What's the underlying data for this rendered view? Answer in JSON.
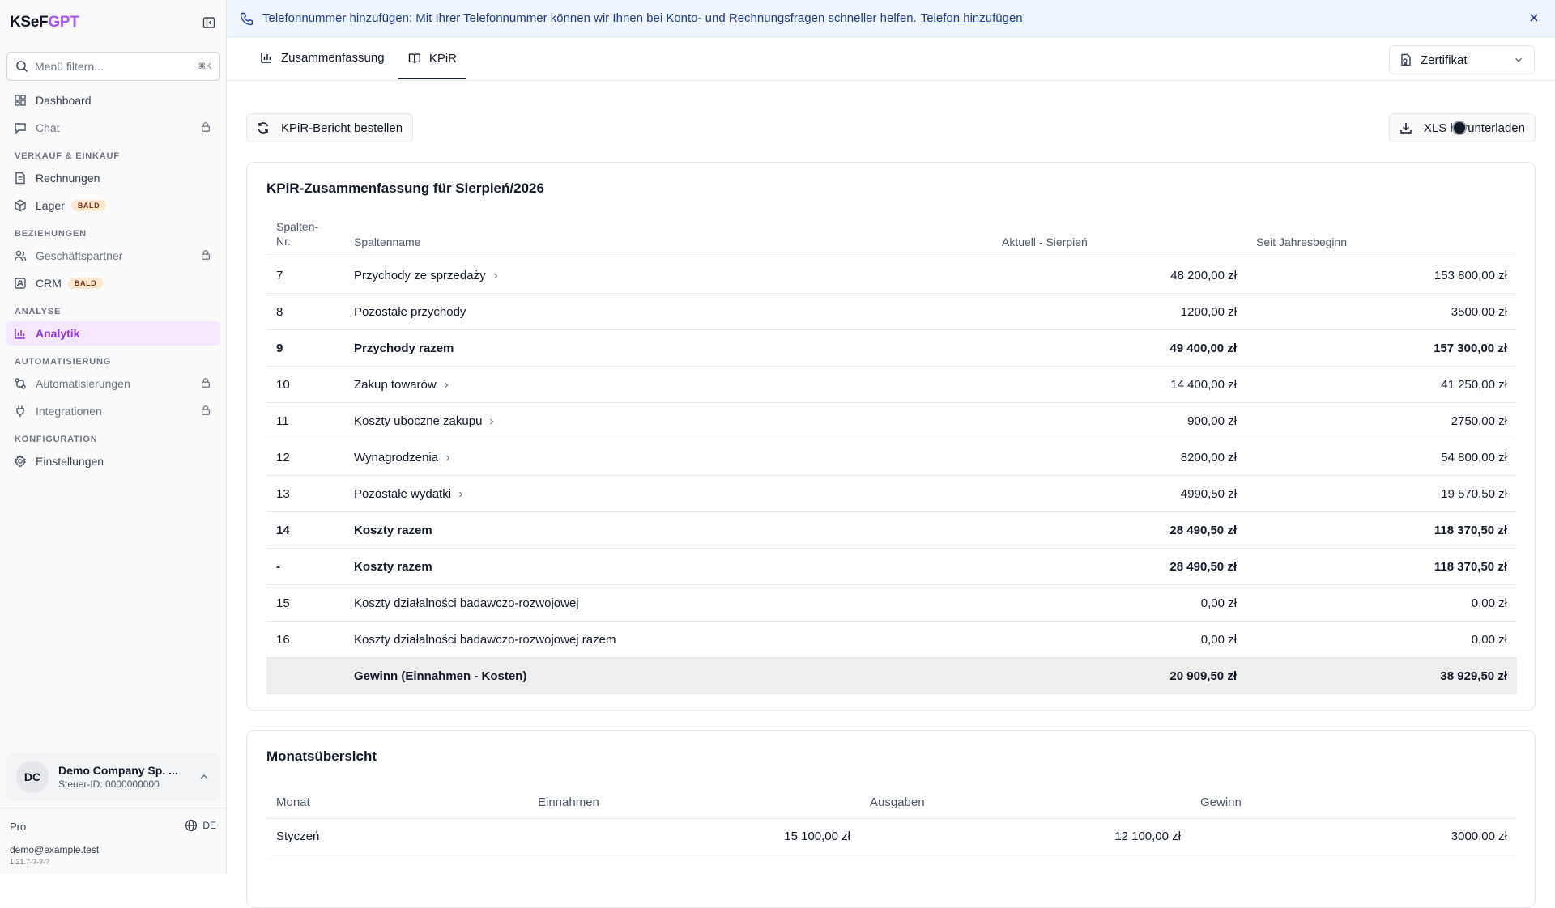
{
  "brand": {
    "name_a": "KSeF",
    "name_b": "GPT"
  },
  "search": {
    "placeholder": "Menü filtern...",
    "shortcut": "⌘K"
  },
  "sidebar": {
    "top_items": [
      {
        "label": "Dashboard",
        "icon": "dashboard-icon"
      },
      {
        "label": "Chat",
        "icon": "chat-icon",
        "locked": true
      }
    ],
    "sections": [
      {
        "title": "VERKAUF & EINKAUF",
        "items": [
          {
            "label": "Rechnungen",
            "icon": "invoice-icon"
          },
          {
            "label": "Lager",
            "icon": "box-icon",
            "badge": "BALD"
          }
        ]
      },
      {
        "title": "BEZIEHUNGEN",
        "items": [
          {
            "label": "Geschäftspartner",
            "icon": "users-icon",
            "locked": true
          },
          {
            "label": "CRM",
            "icon": "contact-icon",
            "badge": "BALD"
          }
        ]
      },
      {
        "title": "ANALYSE",
        "items": [
          {
            "label": "Analytik",
            "icon": "bar-chart-icon",
            "active": true
          }
        ]
      },
      {
        "title": "AUTOMATISIERUNG",
        "items": [
          {
            "label": "Automatisierungen",
            "icon": "workflow-icon",
            "locked": true
          },
          {
            "label": "Integrationen",
            "icon": "plug-icon",
            "locked": true
          }
        ]
      },
      {
        "title": "KONFIGURATION",
        "items": [
          {
            "label": "Einstellungen",
            "icon": "gear-icon"
          }
        ]
      }
    ]
  },
  "company": {
    "initials": "DC",
    "name": "Demo Company Sp. ...",
    "tax_id": "Steuer-ID: 0000000000"
  },
  "footer": {
    "plan": "Pro",
    "language": "DE",
    "email": "demo@example.test",
    "version": "1.21.7-?-?-?"
  },
  "banner": {
    "text": "Telefonnummer hinzufügen: Mit Ihrer Telefonnummer können wir Ihnen bei Konto- und Rechnungsfragen schneller helfen.",
    "link": "Telefon hinzufügen"
  },
  "tabs": [
    {
      "label": "Zusammenfassung",
      "icon": "bar-chart-icon"
    },
    {
      "label": "KPiR",
      "icon": "book-icon",
      "active": true
    }
  ],
  "certificate": {
    "label": "Zertifikat"
  },
  "actions": {
    "order_report": "KPiR-Bericht bestellen",
    "download_xls": "XLS herunterladen"
  },
  "kpir": {
    "title": "KPiR-Zusammenfassung für Sierpień/2026",
    "columns": [
      "Spalten-\nNr.",
      "Spaltenname",
      "Aktuell - Sierpień",
      "Seit Jahresbeginn"
    ],
    "rows": [
      {
        "nr": "7",
        "name": "Przychody ze sprzedaży",
        "current": "48 200,00 zł",
        "ytd": "153 800,00 zł",
        "expandable": true
      },
      {
        "nr": "8",
        "name": "Pozostałe przychody",
        "current": "1200,00 zł",
        "ytd": "3500,00 zł"
      },
      {
        "nr": "9",
        "name": "Przychody razem",
        "current": "49 400,00 zł",
        "ytd": "157 300,00 zł",
        "bold": true
      },
      {
        "nr": "10",
        "name": "Zakup towarów",
        "current": "14 400,00 zł",
        "ytd": "41 250,00 zł",
        "expandable": true
      },
      {
        "nr": "11",
        "name": "Koszty uboczne zakupu",
        "current": "900,00 zł",
        "ytd": "2750,00 zł",
        "expandable": true
      },
      {
        "nr": "12",
        "name": "Wynagrodzenia",
        "current": "8200,00 zł",
        "ytd": "54 800,00 zł",
        "expandable": true
      },
      {
        "nr": "13",
        "name": "Pozostałe wydatki",
        "current": "4990,50 zł",
        "ytd": "19 570,50 zł",
        "expandable": true
      },
      {
        "nr": "14",
        "name": "Koszty razem",
        "current": "28 490,50 zł",
        "ytd": "118 370,50 zł",
        "bold": true
      },
      {
        "nr": "-",
        "name": "Koszty razem",
        "current": "28 490,50 zł",
        "ytd": "118 370,50 zł",
        "bold": true
      },
      {
        "nr": "15",
        "name": "Koszty działalności badawczo-rozwojowej",
        "current": "0,00 zł",
        "ytd": "0,00 zł"
      },
      {
        "nr": "16",
        "name": "Koszty działalności badawczo-rozwojowej razem",
        "current": "0,00 zł",
        "ytd": "0,00 zł"
      }
    ],
    "total": {
      "nr": "",
      "name": "Gewinn (Einnahmen - Kosten)",
      "current": "20 909,50 zł",
      "ytd": "38 929,50 zł"
    }
  },
  "monthly": {
    "title": "Monatsübersicht",
    "columns": [
      "Monat",
      "Einnahmen",
      "Ausgaben",
      "Gewinn"
    ],
    "rows": [
      {
        "month": "Styczeń",
        "income": "15 100,00 zł",
        "expenses": "12 100,00 zł",
        "profit": "3000,00 zł"
      }
    ]
  }
}
